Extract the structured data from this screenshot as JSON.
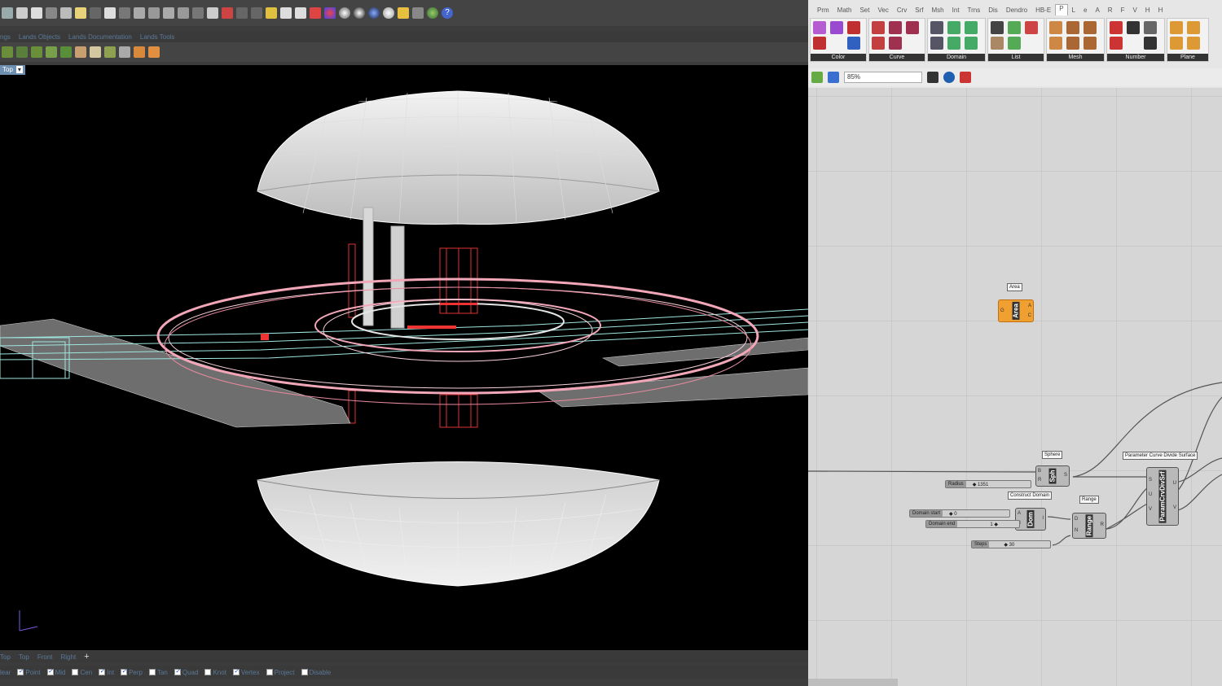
{
  "rhino": {
    "toolbar_tabs": [
      "ngs",
      "Lands Objects",
      "Lands Documentation",
      "Lands Tools"
    ],
    "viewport_label": "Top",
    "viewport_menu_glyph": "▾",
    "view_tabs": [
      "Top",
      "Top",
      "Front",
      "Right"
    ],
    "view_tab_add": "+",
    "osnaps": [
      {
        "label": "Near",
        "checked": false,
        "clipped_label": "lear"
      },
      {
        "label": "Point",
        "checked": true
      },
      {
        "label": "Mid",
        "checked": true
      },
      {
        "label": "Cen",
        "checked": false
      },
      {
        "label": "Int",
        "checked": true
      },
      {
        "label": "Perp",
        "checked": true
      },
      {
        "label": "Tan",
        "checked": false
      },
      {
        "label": "Quad",
        "checked": true
      },
      {
        "label": "Knot",
        "checked": false
      },
      {
        "label": "Vertex",
        "checked": true
      },
      {
        "label": "Project",
        "checked": false
      },
      {
        "label": "Disable",
        "checked": false
      }
    ]
  },
  "grasshopper": {
    "menu_tabs": [
      "Prm",
      "Math",
      "Set",
      "Vec",
      "Crv",
      "Srf",
      "Msh",
      "Int",
      "Trns",
      "Dis",
      "Dendro",
      "HB-E",
      "P",
      "L",
      "e",
      "A",
      "R",
      "F",
      "V",
      "H",
      "H"
    ],
    "active_tab": "P",
    "ribbon_groups": [
      "Color",
      "Curve",
      "Domain",
      "List",
      "Mesh",
      "Number",
      "Plane"
    ],
    "zoom": "85%",
    "components": {
      "area": {
        "tooltip": "Area",
        "name": "Area",
        "in": "G",
        "out_a": "A",
        "out_c": "C"
      },
      "sphere": {
        "tooltip": "Sphere",
        "name": "Sph",
        "in_b": "B",
        "in_r": "R",
        "out": "S"
      },
      "domain": {
        "tooltip": "Construct Domain",
        "name": "Dom",
        "in_a": "A",
        "in_b": "B",
        "out": "I"
      },
      "range": {
        "tooltip": "Range",
        "name": "Range",
        "in_d": "D",
        "in_n": "N",
        "out": "R"
      },
      "param": {
        "tooltip": "Parameter Curve Divide Surface",
        "name": "ParamCrvDivSrf",
        "in_s": "S",
        "in_u": "U",
        "in_v": "V",
        "out_u": "U",
        "out_v": "V"
      }
    },
    "sliders": {
      "radius": {
        "label": "Radius",
        "value": "◆ 1351"
      },
      "domain_start": {
        "label": "Domain start",
        "value": "◆ 0"
      },
      "domain_end": {
        "label": "Domain end",
        "value": "1 ◆"
      },
      "steps": {
        "label": "Steps",
        "value": "◆ 30"
      }
    }
  }
}
